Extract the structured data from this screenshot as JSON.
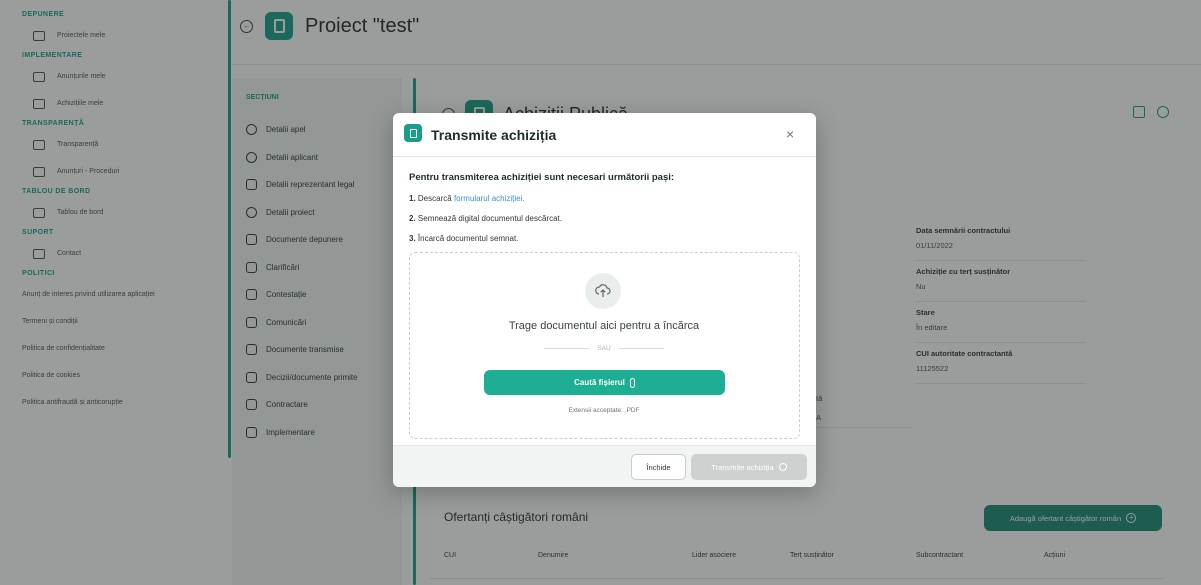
{
  "sidebar": {
    "sections": [
      {
        "heading": "DEPUNERE",
        "items": [
          {
            "label": "Proiectele mele",
            "icon": "document-plus-icon"
          }
        ]
      },
      {
        "heading": "IMPLEMENTARE",
        "items": [
          {
            "label": "Anunțurile mele",
            "icon": "folder-icon"
          },
          {
            "label": "Achizițiile mele",
            "icon": "document-icon"
          }
        ]
      },
      {
        "heading": "TRANSPARENȚĂ",
        "items": [
          {
            "label": "Transparență",
            "icon": "table-icon"
          },
          {
            "label": "Anunțuri - Proceduri",
            "icon": "copy-icon"
          }
        ]
      },
      {
        "heading": "TABLOU DE BORD",
        "items": [
          {
            "label": "Tablou de bord",
            "icon": "monitor-icon"
          }
        ]
      },
      {
        "heading": "SUPORT",
        "items": [
          {
            "label": "Contact",
            "icon": "mail-icon"
          }
        ]
      }
    ],
    "politici_heading": "POLITICI",
    "politici": [
      "Anunț de interes privind utilizarea aplicației",
      "Termeni și condiții",
      "Politica de confidențialitate",
      "Politica de cookies",
      "Politica antifraudă și anticorupție"
    ]
  },
  "header": {
    "back_icon": "arrow-left-circle-icon",
    "project_title": "Proiect \"test\""
  },
  "sections_panel": {
    "heading": "SECȚIUNI",
    "items": [
      "Detalii apel",
      "Detalii aplicant",
      "Detalii reprezentant legal",
      "Detalii proiect",
      "Documente depunere",
      "Clarificări",
      "Contestație",
      "Comunicări",
      "Documente transmise",
      "Decizii/documente primite",
      "Contractare",
      "Implementare"
    ]
  },
  "content": {
    "title": "Achiziții Publică",
    "tools": [
      "edit-icon",
      "send-icon"
    ],
    "fields": [
      {
        "label": "Data semnării contractului",
        "value": "01/11/2022"
      },
      {
        "label": "Achiziție cu terț susținător",
        "value": "Nu"
      },
      {
        "label": "Stare",
        "value": "În editare"
      },
      {
        "label": "CUI autoritate contractantă",
        "value": "11125522"
      }
    ],
    "fragments": [
      "ntă",
      "IIA"
    ],
    "winners_title": "Ofertanți câștigători români",
    "add_winner_button": "Adaugă ofertant câștigător român",
    "table_headers": [
      "CUI",
      "Denumire",
      "Lider asociere",
      "Terț susținător",
      "Subcontractant",
      "Acțiuni"
    ]
  },
  "modal": {
    "title": "Transmite achiziția",
    "close_glyph": "×",
    "intro": "Pentru transmiterea achiziției sunt necesari următorii pași:",
    "step1_num": "1.",
    "step1_text": "Descarcă",
    "step1_link": "formularul achiziției.",
    "step2_num": "2.",
    "step2_text": "Semnează digital documentul descărcat.",
    "step3_num": "3.",
    "step3_text": "Încarcă documentul semnat.",
    "drop_text": "Trage documentul aici pentru a încărca",
    "or_text": "SAU",
    "browse_button": "Caută fișierul",
    "accepted_ext": "Extensii acceptate: .PDF",
    "footer": {
      "close_button": "Închide",
      "submit_button": "Transmite achiziția"
    }
  }
}
